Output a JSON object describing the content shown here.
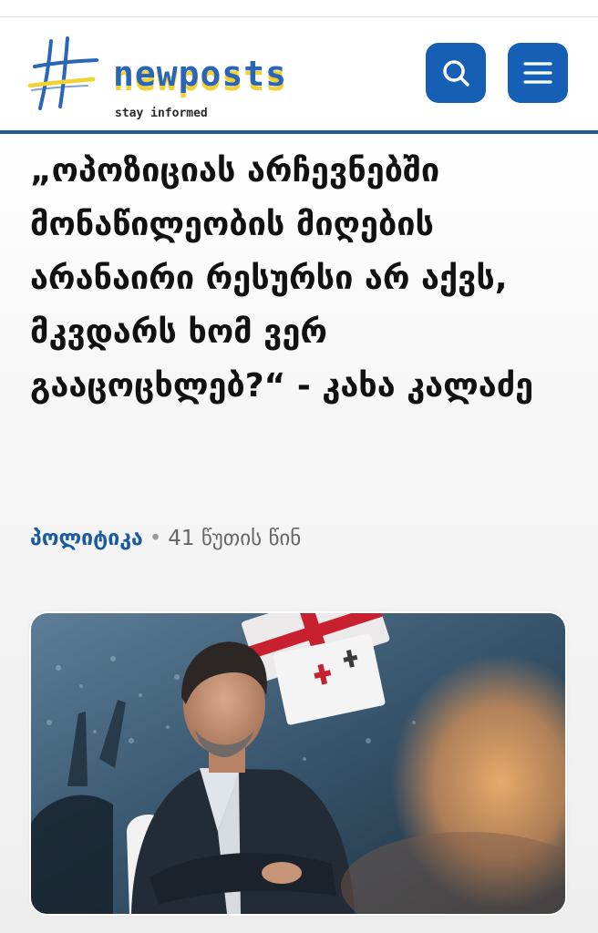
{
  "header": {
    "logo_name": "newposts",
    "logo_tagline": "stay informed",
    "search_icon": "search-icon",
    "menu_icon": "hamburger-menu-icon",
    "accent_color": "#1560b5",
    "logo_yellow": "#f2d230"
  },
  "article": {
    "title": "„ოპოზიციას არჩევნებში მონაწილეობის მიღების არანაირი რესურსი არ აქვს, მკვდარს ხომ ვერ გააცოცხლებ?“ - კახა კალაძე",
    "category": "პოლიტიკა",
    "separator": "•",
    "time_ago": "41 წუთის წინ"
  }
}
